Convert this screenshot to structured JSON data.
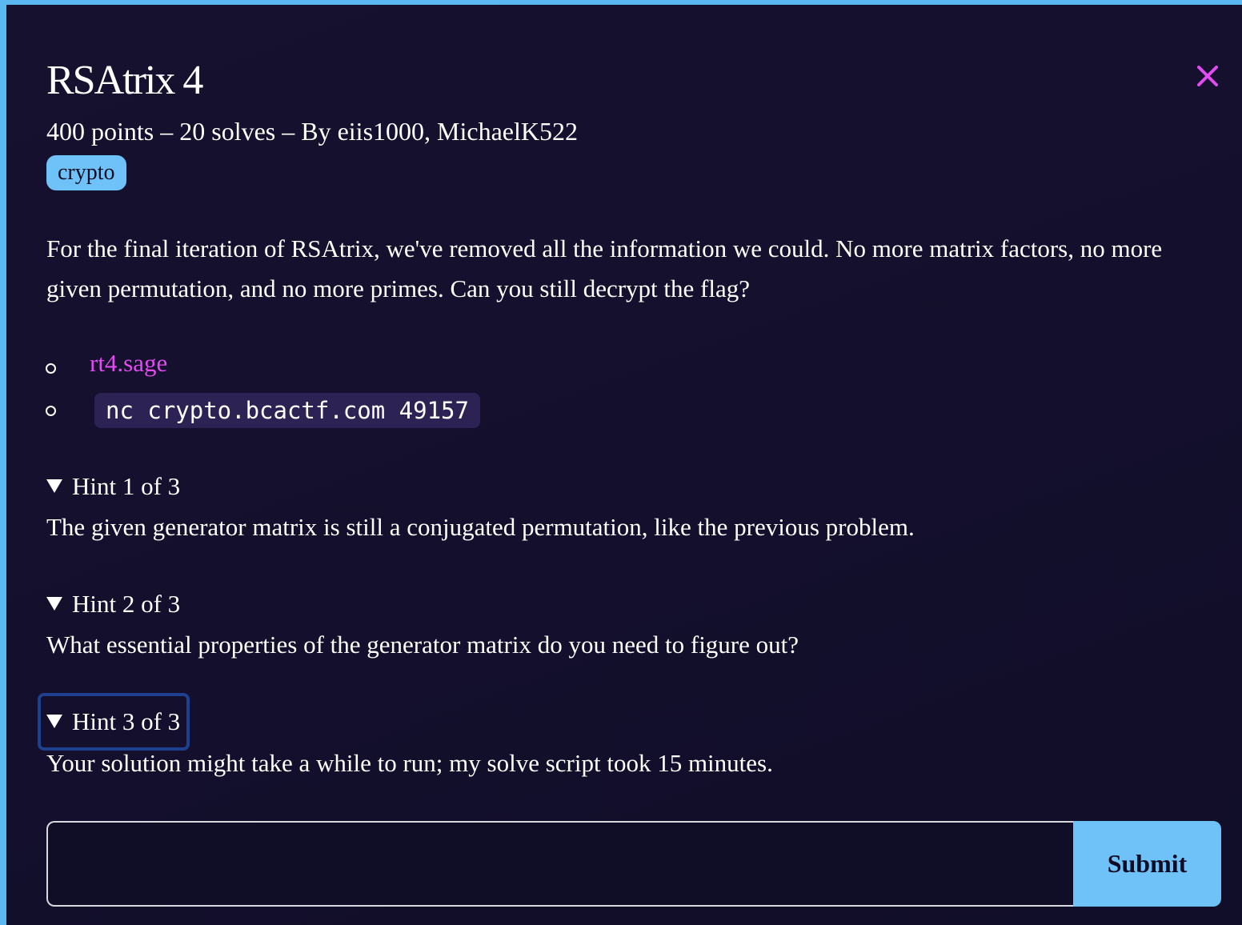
{
  "challenge": {
    "title": "RSAtrix 4",
    "meta": "400 points – 20 solves – By eiis1000, MichaelK522",
    "tag": "crypto",
    "description": "For the final iteration of RSAtrix, we've removed all the information we could. No more matrix factors, no more given permutation, and no more primes. Can you still decrypt the flag?",
    "attachments": [
      {
        "label": "rt4.sage",
        "type": "link"
      },
      {
        "label": "nc crypto.bcactf.com 49157",
        "type": "code"
      }
    ],
    "hints": [
      {
        "label": "Hint 1 of 3",
        "text": "The given generator matrix is still a conjugated permutation, like the previous problem."
      },
      {
        "label": "Hint 2 of 3",
        "text": "What essential properties of the generator matrix do you need to figure out?"
      },
      {
        "label": "Hint 3 of 3",
        "text": "Your solution might take a while to run; my solve script took 15 minutes."
      }
    ]
  },
  "flag_form": {
    "input_value": "",
    "input_placeholder": "",
    "submit_label": "Submit"
  },
  "colors": {
    "accent": "#6ec2f7",
    "link": "#e24bf0",
    "close": "#e24bf0",
    "background": "#130f2c"
  },
  "icons": {
    "close": "close-icon",
    "bullet": "hollow-circle-bullet",
    "disclosure": "disclosure-triangle-down"
  }
}
